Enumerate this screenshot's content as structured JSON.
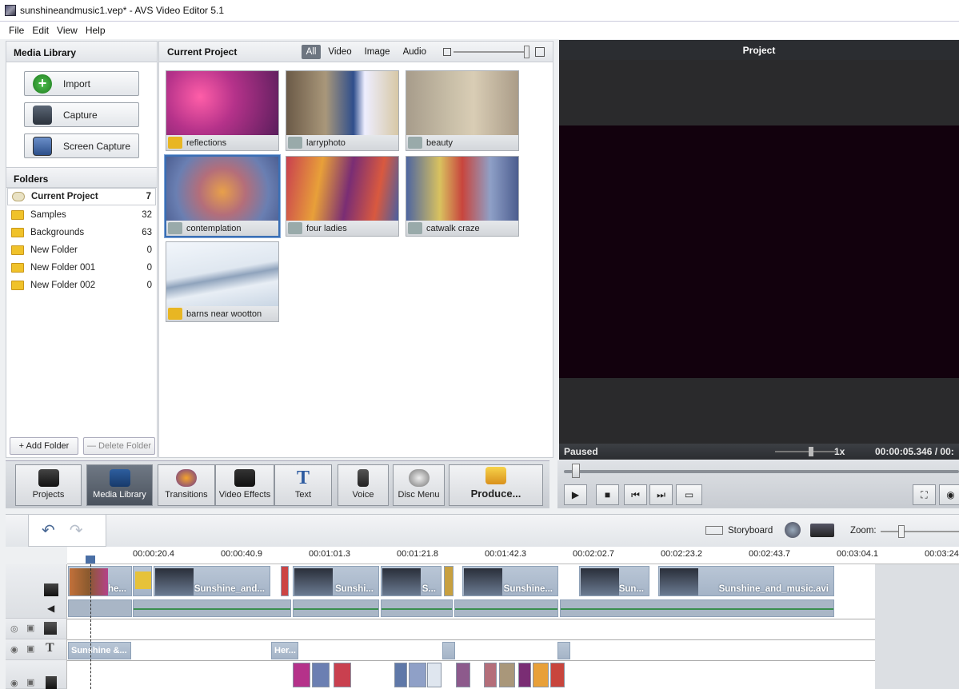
{
  "app": {
    "title": "sunshineandmusic1.vep* - AVS Video Editor 5.1"
  },
  "menu": [
    "File",
    "Edit",
    "View",
    "Help"
  ],
  "media_library": {
    "title": "Media Library",
    "import": "Import",
    "capture": "Capture",
    "screen_capture": "Screen Capture"
  },
  "folders": {
    "title": "Folders",
    "items": [
      {
        "name": "Current Project",
        "count": "7"
      },
      {
        "name": "Samples",
        "count": "32"
      },
      {
        "name": "Backgrounds",
        "count": "63"
      },
      {
        "name": "New Folder",
        "count": "0"
      },
      {
        "name": "New Folder 001",
        "count": "0"
      },
      {
        "name": "New Folder 002",
        "count": "0"
      }
    ],
    "add": "+ Add Folder",
    "delete": "— Delete Folder"
  },
  "current_project": {
    "title": "Current Project",
    "filters": [
      "All",
      "Video",
      "Image",
      "Audio"
    ],
    "thumbs": [
      {
        "label": "reflections",
        "color": "#b5328a"
      },
      {
        "label": "larryphoto",
        "color": "#8d7a5c"
      },
      {
        "label": "beauty",
        "color": "#b3a692"
      },
      {
        "label": "contemplation",
        "color": "#8f78a6"
      },
      {
        "label": "four ladies",
        "color": "#b24a63"
      },
      {
        "label": "catwalk craze",
        "color": "#5f78a8"
      },
      {
        "label": "barns near wootton",
        "color": "#dfe6ef"
      }
    ]
  },
  "preview": {
    "title": "Project",
    "status": "Paused",
    "speed": "1x",
    "time": "00:00:05.346 / 00:"
  },
  "toolbar": {
    "projects": "Projects",
    "media_library": "Media Library",
    "transitions": "Transitions",
    "video_effects": "Video Effects",
    "text": "Text",
    "voice": "Voice",
    "disc_menu": "Disc Menu",
    "produce": "Produce..."
  },
  "timeline": {
    "storyboard": "Storyboard",
    "zoom": "Zoom:",
    "ticks": [
      "00:00:20.4",
      "00:00:40.9",
      "00:01:01.3",
      "00:01:21.8",
      "00:01:42.3",
      "00:02:02.7",
      "00:02:23.2",
      "00:02:43.7",
      "00:03:04.1",
      "00:03:24"
    ],
    "clips": [
      "he...",
      "Sunshine_and...",
      "Sunshi...",
      "S...",
      "Sunshine...",
      "Sun...",
      "Sunshine_and_music.avi"
    ],
    "text_clips": [
      "Sunshine &...",
      "Her..."
    ]
  }
}
